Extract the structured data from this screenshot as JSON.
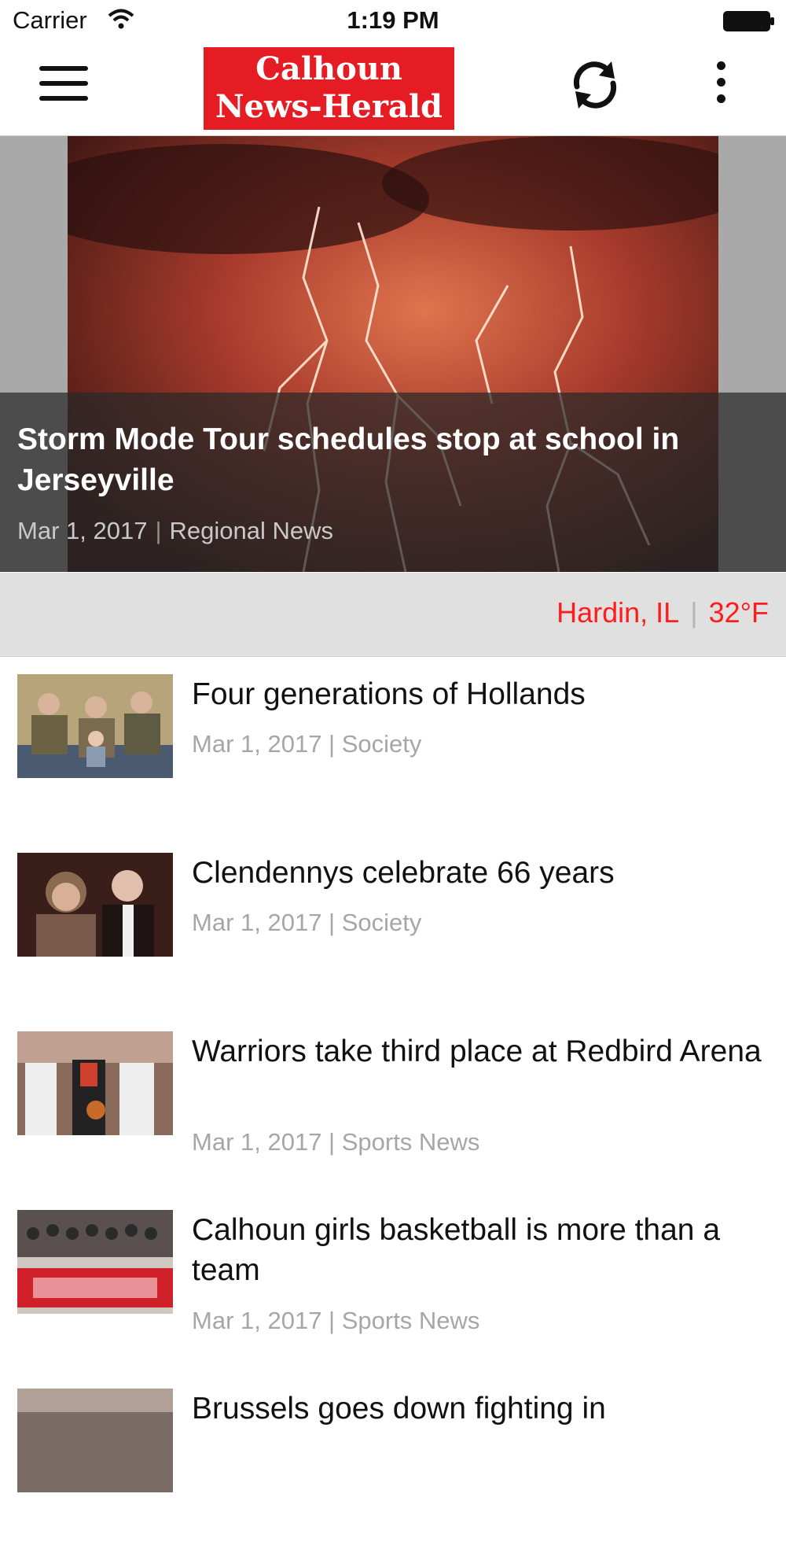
{
  "status_bar": {
    "carrier": "Carrier",
    "time": "1:19 PM"
  },
  "header": {
    "logo_line1": "Calhoun",
    "logo_line2": "News-Herald"
  },
  "hero": {
    "title": "Storm Mode Tour schedules stop at school in Jerseyville",
    "date": "Mar 1, 2017",
    "separator": "|",
    "category": "Regional News"
  },
  "weather": {
    "location": "Hardin, IL",
    "separator": "|",
    "temperature": "32°F",
    "color": "#ff1c1c"
  },
  "articles": [
    {
      "title": "Four generations of Hollands",
      "meta": "Mar 1, 2017 | Society"
    },
    {
      "title": "Clendennys celebrate 66 years",
      "meta": "Mar 1, 2017 | Society"
    },
    {
      "title": "Warriors take third place at Redbird Arena",
      "meta": "Mar 1, 2017 | Sports News"
    },
    {
      "title": "Calhoun girls basketball is more than a team",
      "meta": "Mar 1, 2017 | Sports News"
    },
    {
      "title": "Brussels goes down fighting in",
      "meta": ""
    }
  ],
  "colors": {
    "brand_red": "#e51c23",
    "weather_red": "#ff1c1c"
  },
  "icons": [
    "wifi-icon",
    "battery-icon",
    "menu-icon",
    "refresh-icon",
    "more-icon"
  ]
}
